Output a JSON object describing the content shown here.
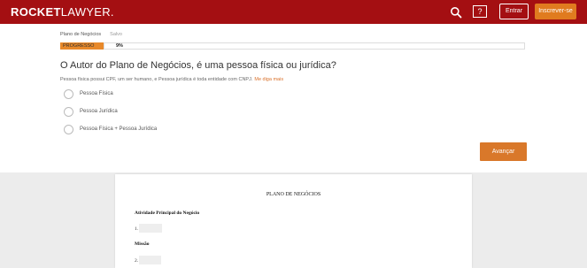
{
  "header": {
    "logo_bold": "ROCKET",
    "logo_thin": "LAWYER.",
    "help_label": "?",
    "login_label": "Entrar",
    "signup_label": "Inscrever-se",
    "colors": {
      "bar": "#a40f12",
      "signup": "#e07b1f"
    }
  },
  "form": {
    "tab_label": "Plano de Negócios",
    "saved_label": "Salvo",
    "progress_label": "PROGRESSO",
    "progress_value": "9%",
    "progress_fraction": 0.09,
    "question": "O Autor do Plano de Negócios, é uma pessoa física ou jurídica?",
    "help_text": "Pessoa física possui CPF, um ser humano, e Pessoa jurídica é toda entidade com CNPJ.",
    "help_more": "Me diga mais",
    "options": [
      "Pessoa Física",
      "Pessoa Jurídica",
      "Pessoa Física + Pessoa Jurídica"
    ],
    "next_label": "Avançar"
  },
  "document": {
    "title": "PLANO DE NEGÓCIOS",
    "section1": "Atividade Principal do Negócio",
    "number1": "1.",
    "section2": "Missão",
    "number2": "2."
  }
}
